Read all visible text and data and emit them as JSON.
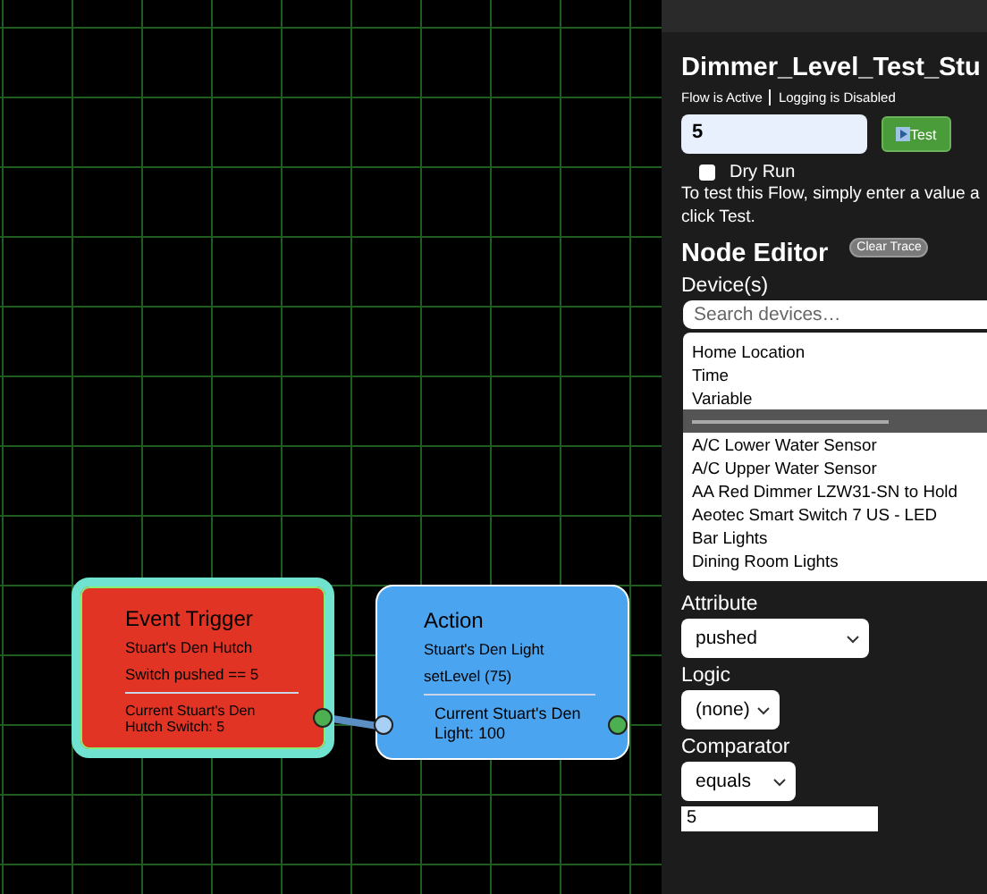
{
  "canvas": {
    "nodes": [
      {
        "kind": "trigger",
        "title": "Event Trigger",
        "lines": [
          "Stuart's Den Hutch",
          "Switch pushed == 5"
        ],
        "status": "Current Stuart's Den Hutch Switch: 5",
        "selected": true
      },
      {
        "kind": "action",
        "title": "Action",
        "lines": [
          "Stuart's Den Light",
          "setLevel (75)"
        ],
        "status": "Current Stuart's Den Light: 100",
        "selected": false
      }
    ]
  },
  "sidebar": {
    "title": "Dimmer_Level_Test_Stu",
    "flow_status": [
      "Flow is Active",
      "Logging is Disabled"
    ],
    "test_input": {
      "value": "5"
    },
    "test_button": "Test",
    "dry_run": {
      "label": "Dry Run",
      "checked": false
    },
    "help_lines": [
      "To test this Flow, simply enter a value a",
      "click Test."
    ],
    "section_title": "Node Editor",
    "clear_trace_button": "Clear Trace",
    "devices": {
      "label": "Device(s)",
      "placeholder": "Search devices…",
      "items": [
        {
          "kind": "option",
          "label": "Home Location",
          "selected": false
        },
        {
          "kind": "option",
          "label": "Time",
          "selected": false
        },
        {
          "kind": "option",
          "label": "Variable",
          "selected": false
        },
        {
          "kind": "separator",
          "selected": true
        },
        {
          "kind": "option",
          "label": "A/C Lower Water Sensor",
          "selected": false
        },
        {
          "kind": "option",
          "label": "A/C Upper Water Sensor",
          "selected": false
        },
        {
          "kind": "option",
          "label": "AA Red Dimmer LZW31-SN to Hold",
          "selected": false
        },
        {
          "kind": "option",
          "label": "Aeotec Smart Switch 7 US - LED",
          "selected": false
        },
        {
          "kind": "option",
          "label": "Bar Lights",
          "selected": false
        },
        {
          "kind": "option",
          "label": "Dining Room Lights",
          "selected": false
        }
      ]
    },
    "attribute": {
      "label": "Attribute",
      "value": "pushed"
    },
    "logic": {
      "label": "Logic",
      "value": "(none)"
    },
    "comparator": {
      "label": "Comparator",
      "value": "equals"
    },
    "value_input": {
      "value": "5"
    }
  }
}
